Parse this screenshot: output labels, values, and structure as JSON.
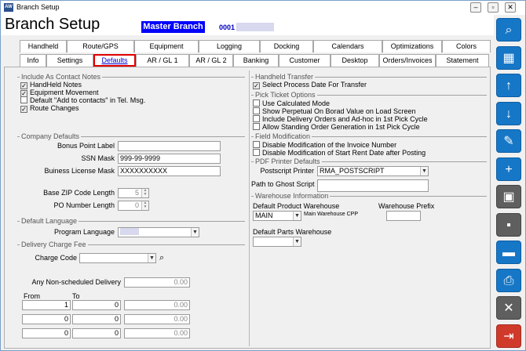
{
  "window": {
    "title": "Branch Setup",
    "min": "‒",
    "restore": "▫",
    "close": "✕"
  },
  "header": {
    "title": "Branch Setup",
    "master_label": "Master Branch",
    "branch_code": "0001"
  },
  "tabs_row1": [
    "Handheld",
    "Route/GPS",
    "Equipment",
    "Logging",
    "Docking",
    "Calendars",
    "Optimizations",
    "Colors"
  ],
  "tabs_row2": [
    "Info",
    "Settings",
    "Defaults",
    "AR / GL 1",
    "AR / GL 2",
    "Banking",
    "Customer",
    "Desktop",
    "Orders/Invoices",
    "Statement"
  ],
  "left": {
    "contact_group": "Include As Contact Notes",
    "contact_items": [
      "HandHeld Notes",
      "Equipment Movement",
      "Default \"Add to contacts\" in Tel. Msg.",
      "Route Changes"
    ],
    "company_group": "Company Defaults",
    "bonus_label": "Bonus Point Label",
    "ssn_label": "SSN Mask",
    "ssn_value": "999-99-9999",
    "license_label": "Buiness License Mask",
    "license_value": "XXXXXXXXXX",
    "zip_label": "Base ZIP Code Length",
    "zip_value": "5",
    "po_label": "PO Number Length",
    "po_value": "0",
    "language_group": "Default Language",
    "language_label": "Program Language",
    "delivery_group": "Delivery Charge Fee",
    "charge_label": "Charge Code",
    "nonsched_label": "Any Non-scheduled Delivery",
    "nonsched_value": "0.00",
    "from_label": "From",
    "to_label": "To",
    "fee_rows": [
      {
        "from": "1",
        "to": "0",
        "amount": "0.00"
      },
      {
        "from": "0",
        "to": "0",
        "amount": "0.00"
      },
      {
        "from": "0",
        "to": "0",
        "amount": "0.00"
      }
    ]
  },
  "right": {
    "handheld_group": "Handheld Transfer",
    "handheld_item": "Select Process Date For Transfer",
    "pick_group": "Pick Ticket Options",
    "pick_items": [
      "Use Calculated Mode",
      "Show Perpetual On Borad Value on Load Screen",
      "Include Delivery Orders and Ad-hoc in 1st Pick Cycle",
      "Allow Standing Order Generation in 1st Pick Cycle"
    ],
    "field_group": "Field Modification",
    "field_items": [
      "Disable Modification of the Invoice Number",
      "Disable Modification of Start Rent Date after Posting"
    ],
    "pdf_group": "PDF Printer Defaults",
    "printer_label": "Postscript Printer",
    "printer_value": "RMA_POSTSCRIPT",
    "ghost_label": "Path to Ghost Script",
    "warehouse_group": "Warehouse Information",
    "product_wh_label": "Default Product Warehouse",
    "product_wh_value": "MAIN",
    "product_wh_desc": "Main Warehouse CPP",
    "prefix_label": "Warehouse Prefix",
    "parts_wh_label": "Default Parts Warehouse"
  },
  "sidebar": [
    "search-icon",
    "grid-icon",
    "arrow-up-icon",
    "arrow-down-icon",
    "pencil-icon",
    "new-document-icon",
    "save-new-icon",
    "save-icon",
    "trash-icon",
    "printer-icon",
    "cancel-icon",
    "exit-icon"
  ],
  "colors": {
    "accent": "#1677c7",
    "master_bg": "#0000ff",
    "selected_tab_border": "#e00000"
  }
}
